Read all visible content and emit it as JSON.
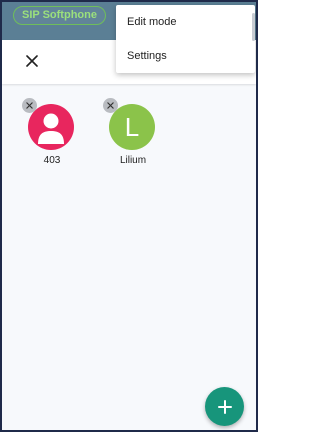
{
  "header": {
    "app_badge": "SIP Softphone"
  },
  "toolbar": {
    "close_icon": "close-icon"
  },
  "menu": {
    "items": [
      {
        "label": "Edit mode"
      },
      {
        "label": "Settings"
      }
    ]
  },
  "contacts": [
    {
      "name": "403",
      "avatar": "person-icon",
      "color": "#e8265e"
    },
    {
      "name": "Lilium",
      "initial": "L",
      "color": "#8bc34a"
    }
  ],
  "fab": {
    "icon": "plus-icon",
    "color": "#17957b"
  },
  "colors": {
    "header_bg": "#5b7f95",
    "badge_green": "#6fbe5a"
  }
}
